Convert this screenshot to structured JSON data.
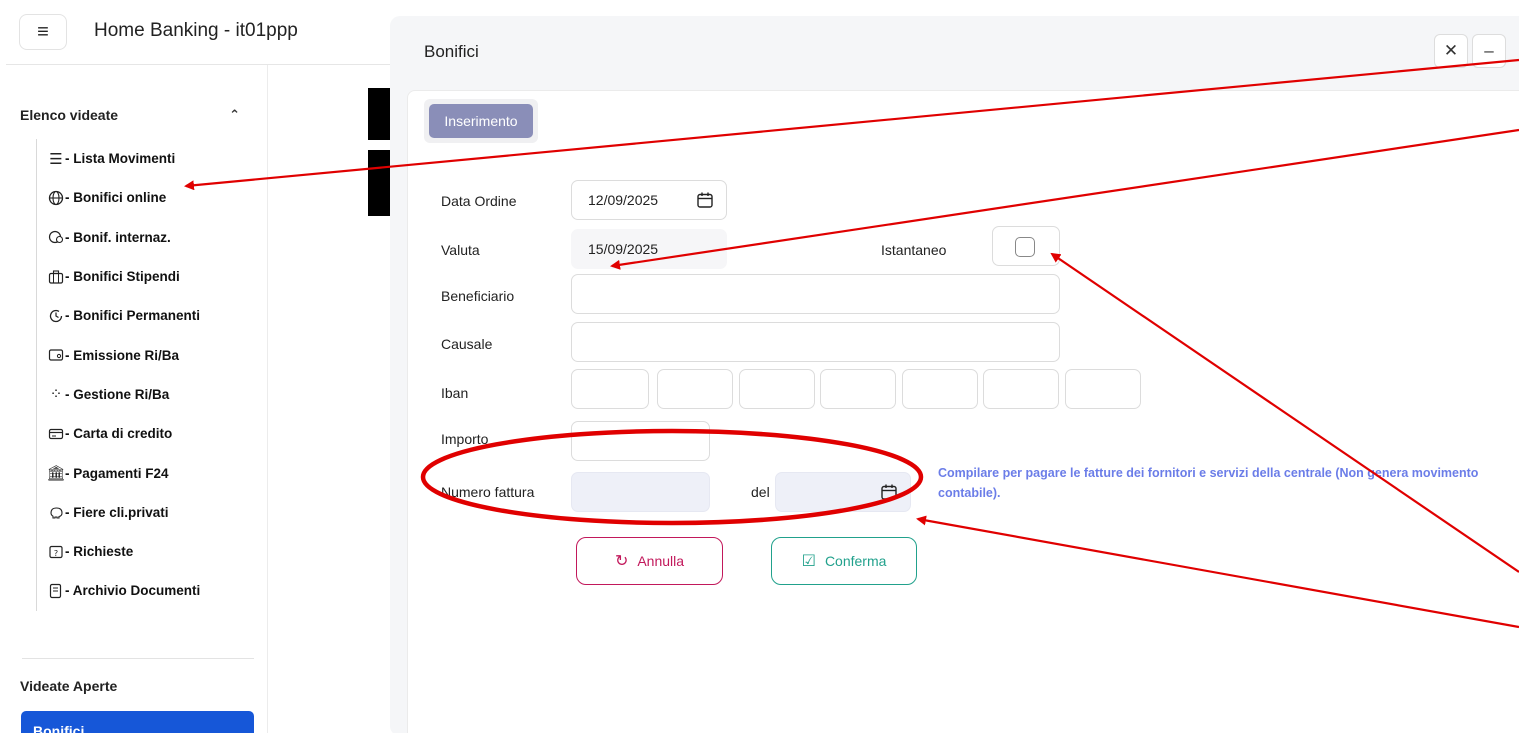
{
  "app": {
    "menu_icon": "hamburger-menu-icon",
    "title": "Home Banking - it01ppp"
  },
  "sidebar": {
    "group_title": "Elenco videate",
    "items": [
      {
        "icon": "list-icon",
        "label": "- Lista Movimenti"
      },
      {
        "icon": "globe-icon",
        "label": "- Bonifici online"
      },
      {
        "icon": "world-transfer-icon",
        "label": "- Bonif. internaz."
      },
      {
        "icon": "briefcase-icon",
        "label": "- Bonifici Stipendi"
      },
      {
        "icon": "clock-repeat-icon",
        "label": "- Bonifici Permanenti"
      },
      {
        "icon": "wallet-icon",
        "label": "- Emissione Ri/Ba"
      },
      {
        "icon": "loader-icon",
        "label": "- Gestione Ri/Ba"
      },
      {
        "icon": "credit-card-icon",
        "label": "- Carta di credito"
      },
      {
        "icon": "bank-icon",
        "label": "- Pagamenti F24"
      },
      {
        "icon": "piggy-bank-icon",
        "label": "- Fiere cli.privati"
      },
      {
        "icon": "question-box-icon",
        "label": "- Richieste"
      },
      {
        "icon": "document-archive-icon",
        "label": "- Archivio Documenti"
      }
    ],
    "open_title": "Videate Aperte",
    "open_items": [
      "Bonifici"
    ]
  },
  "dialog": {
    "title": "Bonifici",
    "tab": "Inserimento",
    "form": {
      "data_ordine": {
        "label": "Data Ordine",
        "value": "12/09/2025"
      },
      "valuta": {
        "label": "Valuta",
        "value": "15/09/2025"
      },
      "istantaneo": {
        "label": "Istantaneo",
        "checked": false
      },
      "beneficiario": {
        "label": "Beneficiario",
        "value": ""
      },
      "causale": {
        "label": "Causale",
        "value": ""
      },
      "iban": {
        "label": "Iban",
        "segments": [
          "",
          "",
          "",
          "",
          "",
          "",
          ""
        ]
      },
      "importo": {
        "label": "Importo",
        "value": ""
      },
      "numero_fattura": {
        "label": "Numero fattura",
        "value": ""
      },
      "del": {
        "label": "del",
        "value": ""
      },
      "hint": "Compilare per pagare le fatture dei fornitori e servizi della centrale (Non genera movimento contabile)."
    },
    "buttons": {
      "cancel": "Annulla",
      "confirm": "Conferma"
    }
  },
  "colors": {
    "primary": "#1657d8",
    "tab": "#8a8eb8",
    "cancel": "#c2185b",
    "confirm": "#21a18c",
    "hint": "#6b7de8",
    "annotation": "#e00000"
  }
}
